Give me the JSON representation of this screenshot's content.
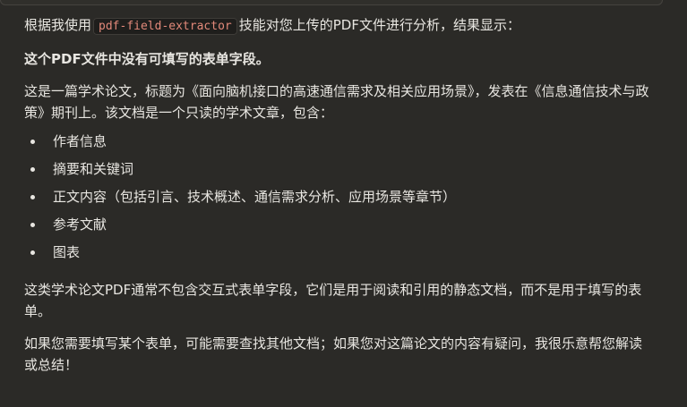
{
  "message": {
    "intro_before": "根据我使用",
    "tool_name": "pdf-field-extractor",
    "intro_after": "技能对您上传的PDF文件进行分析，结果显示：",
    "finding": "这个PDF文件中没有可填写的表单字段。",
    "description": "这是一篇学术论文，标题为《面向脑机接口的高速通信需求及相关应用场景》，发表在《信息通信技术与政策》期刊上。该文档是一个只读的学术文章，包含：",
    "items": [
      "作者信息",
      "摘要和关键词",
      "正文内容（包括引言、技术概述、通信需求分析、应用场景等章节）",
      "参考文献",
      "图表"
    ],
    "note": "这类学术论文PDF通常不包含交互式表单字段，它们是用于阅读和引用的静态文档，而不是用于填写的表单。",
    "closing": "如果您需要填写某个表单，可能需要查找其他文档；如果您对这篇论文的内容有疑问，我很乐意帮您解读或总结！"
  }
}
